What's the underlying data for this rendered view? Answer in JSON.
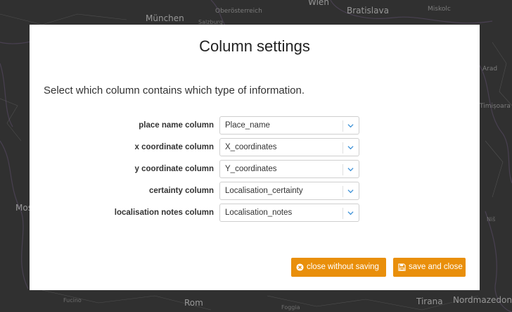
{
  "map": {
    "places": [
      {
        "name": "Wien",
        "cls": "l"
      },
      {
        "name": "München",
        "cls": "l"
      },
      {
        "name": "Bratislava",
        "cls": "l"
      },
      {
        "name": "Oberösterreich",
        "cls": "s"
      },
      {
        "name": "Salzburg",
        "cls": "xs"
      },
      {
        "name": "Miskolc",
        "cls": "s"
      },
      {
        "name": "Mosoly",
        "cls": "l"
      },
      {
        "name": "Rom",
        "cls": "l"
      },
      {
        "name": "Tirana",
        "cls": "l"
      },
      {
        "name": "Nordmazedonien",
        "cls": "l"
      },
      {
        "name": "Arad",
        "cls": "s"
      },
      {
        "name": "Timișoara",
        "cls": "s"
      },
      {
        "name": "Foggia",
        "cls": "xs"
      },
      {
        "name": "Niš",
        "cls": "xs"
      },
      {
        "name": "Fucino",
        "cls": "xs"
      }
    ]
  },
  "modal": {
    "title": "Column settings",
    "intro": "Select which column contains which type of information.",
    "rows": [
      {
        "label": "place name column",
        "value": "Place_name"
      },
      {
        "label": "x coordinate column",
        "value": "X_coordinates"
      },
      {
        "label": "y coordinate column",
        "value": "Y_coordinates"
      },
      {
        "label": "certainty column",
        "value": "Localisation_certainty"
      },
      {
        "label": "localisation notes column",
        "value": "Localisation_notes"
      }
    ],
    "buttons": {
      "close_label": "close without saving",
      "close_icon": "times-circle-icon",
      "save_label": "save and close",
      "save_icon": "floppy-disk-icon"
    },
    "colors": {
      "button": "#e98f0b",
      "chevron": "#3a8fd6"
    }
  }
}
